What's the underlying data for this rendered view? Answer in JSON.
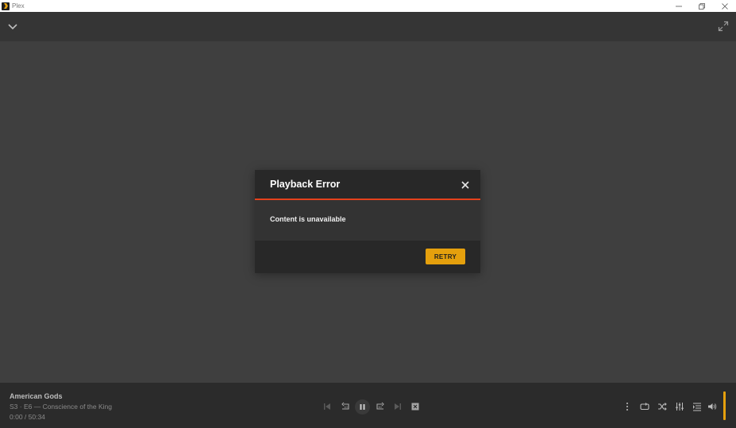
{
  "window": {
    "title": "Plex"
  },
  "dialog": {
    "title": "Playback Error",
    "message": "Content is unavailable",
    "retry_label": "RETRY"
  },
  "now_playing": {
    "show": "American Gods",
    "episode": "S3 · E6 — Conscience of the King",
    "time": "0:00 / 50:34"
  },
  "icons": {
    "titlebar": [
      "plex-logo-icon",
      "minimize-icon",
      "restore-icon",
      "close-icon"
    ],
    "topbar": [
      "chevron-down-icon",
      "fullscreen-icon"
    ],
    "transport": [
      "skip-previous-icon",
      "replay-10-icon",
      "pause-icon",
      "forward-30-icon",
      "skip-next-icon",
      "stop-icon"
    ],
    "right_controls": [
      "more-vertical-icon",
      "repeat-icon",
      "shuffle-icon",
      "equalizer-icon",
      "play-queue-icon",
      "volume-icon"
    ]
  },
  "colors": {
    "accent": "#e5a00d",
    "error_line": "#e5411c",
    "dialog_bg": "#282828",
    "stage_bg": "#3f3f3f"
  }
}
